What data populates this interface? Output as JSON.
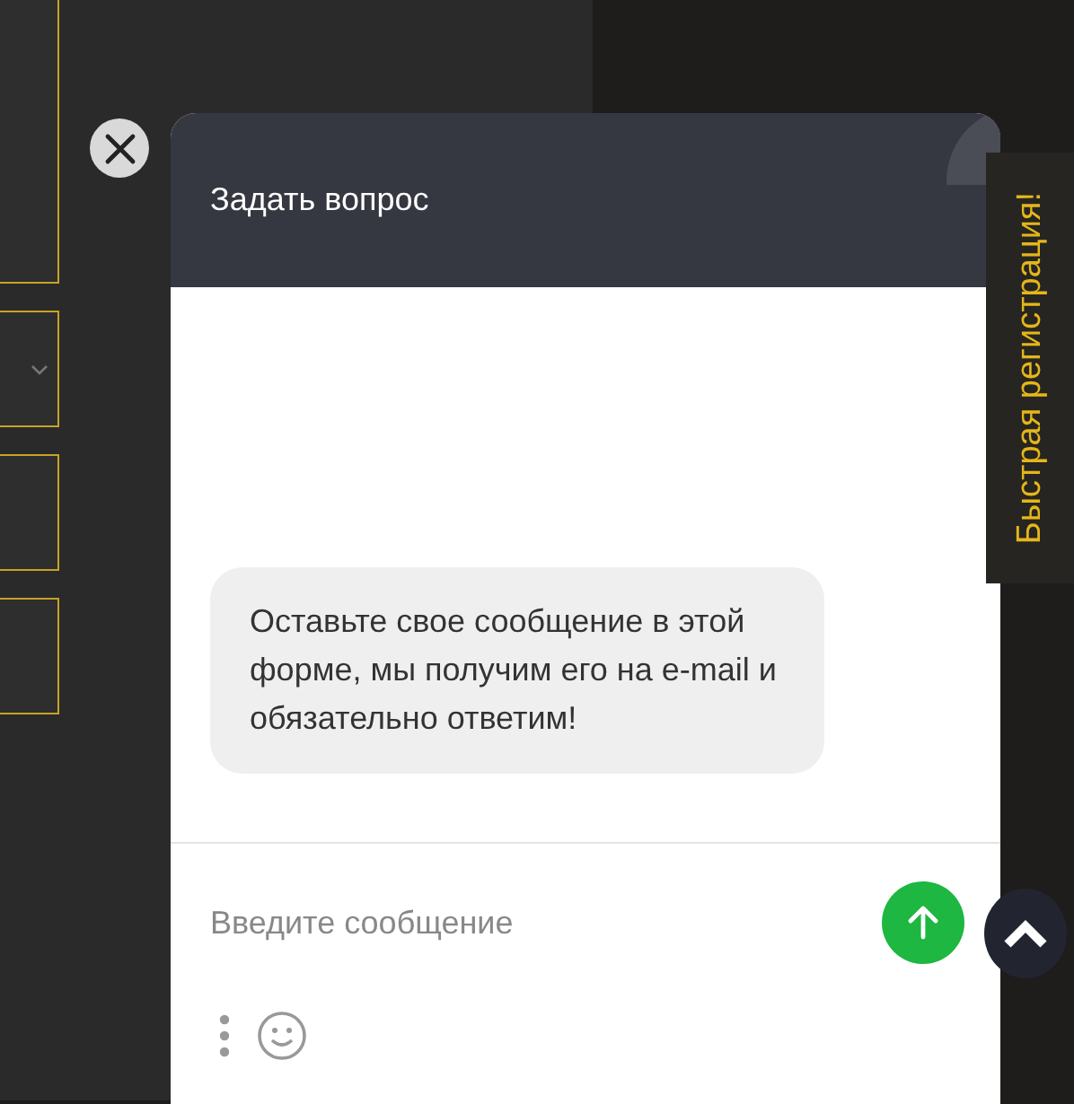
{
  "page_form": {
    "fields": [
      {
        "kind": "text"
      },
      {
        "kind": "select"
      },
      {
        "kind": "text"
      },
      {
        "kind": "text"
      }
    ]
  },
  "chat": {
    "title": "Задать вопрос",
    "messages": [
      {
        "text": "Оставьте свое сообщение в этой форме, мы получим его на e-mail и обязательно ответим!"
      }
    ],
    "input": {
      "placeholder": "Введите сообщение"
    }
  },
  "side_tab": {
    "label": "Быстрая регистрация!"
  }
}
